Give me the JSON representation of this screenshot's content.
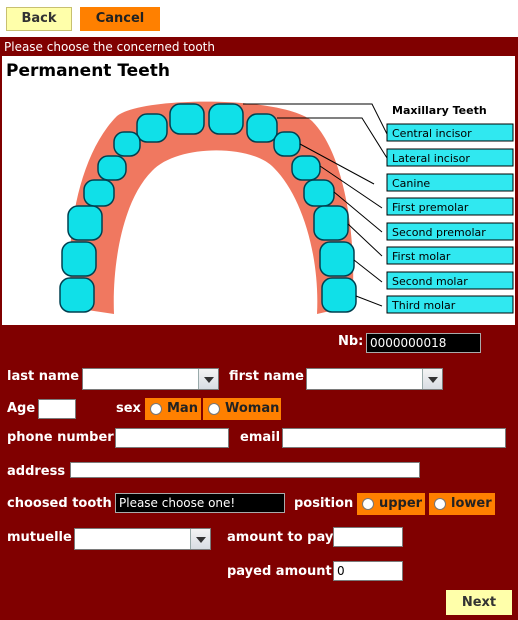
{
  "toolbar": {
    "back_label": "Back",
    "cancel_label": "Cancel"
  },
  "prompt": "Please choose the concerned tooth",
  "diagram": {
    "title": "Permanent Teeth",
    "subtitle": "Maxillary Teeth",
    "labels": [
      "Central incisor",
      "Lateral incisor",
      "Canine",
      "First premolar",
      "Second premolar",
      "First molar",
      "Second molar",
      "Third molar"
    ]
  },
  "form": {
    "nb_label": "Nb:",
    "nb_value": "0000000018",
    "last_name_label": "last name",
    "first_name_label": "first name",
    "age_label": "Age",
    "sex_label": "sex",
    "sex_options": [
      "Man",
      "Woman"
    ],
    "phone_label": "phone number",
    "email_label": "email",
    "address_label": "address",
    "tooth_label": "choosed tooth",
    "tooth_value": "Please choose one!",
    "position_label": "position",
    "position_options": [
      "upper",
      "lower"
    ],
    "mutuelle_label": "mutuelle",
    "amount_label": "amount to pay",
    "payed_label": "payed amount",
    "payed_value": "0",
    "next_label": "Next"
  },
  "colors": {
    "background": "#800000",
    "orange": "#ff8000",
    "teeth": "#00e0e8",
    "gum": "#f07860"
  }
}
